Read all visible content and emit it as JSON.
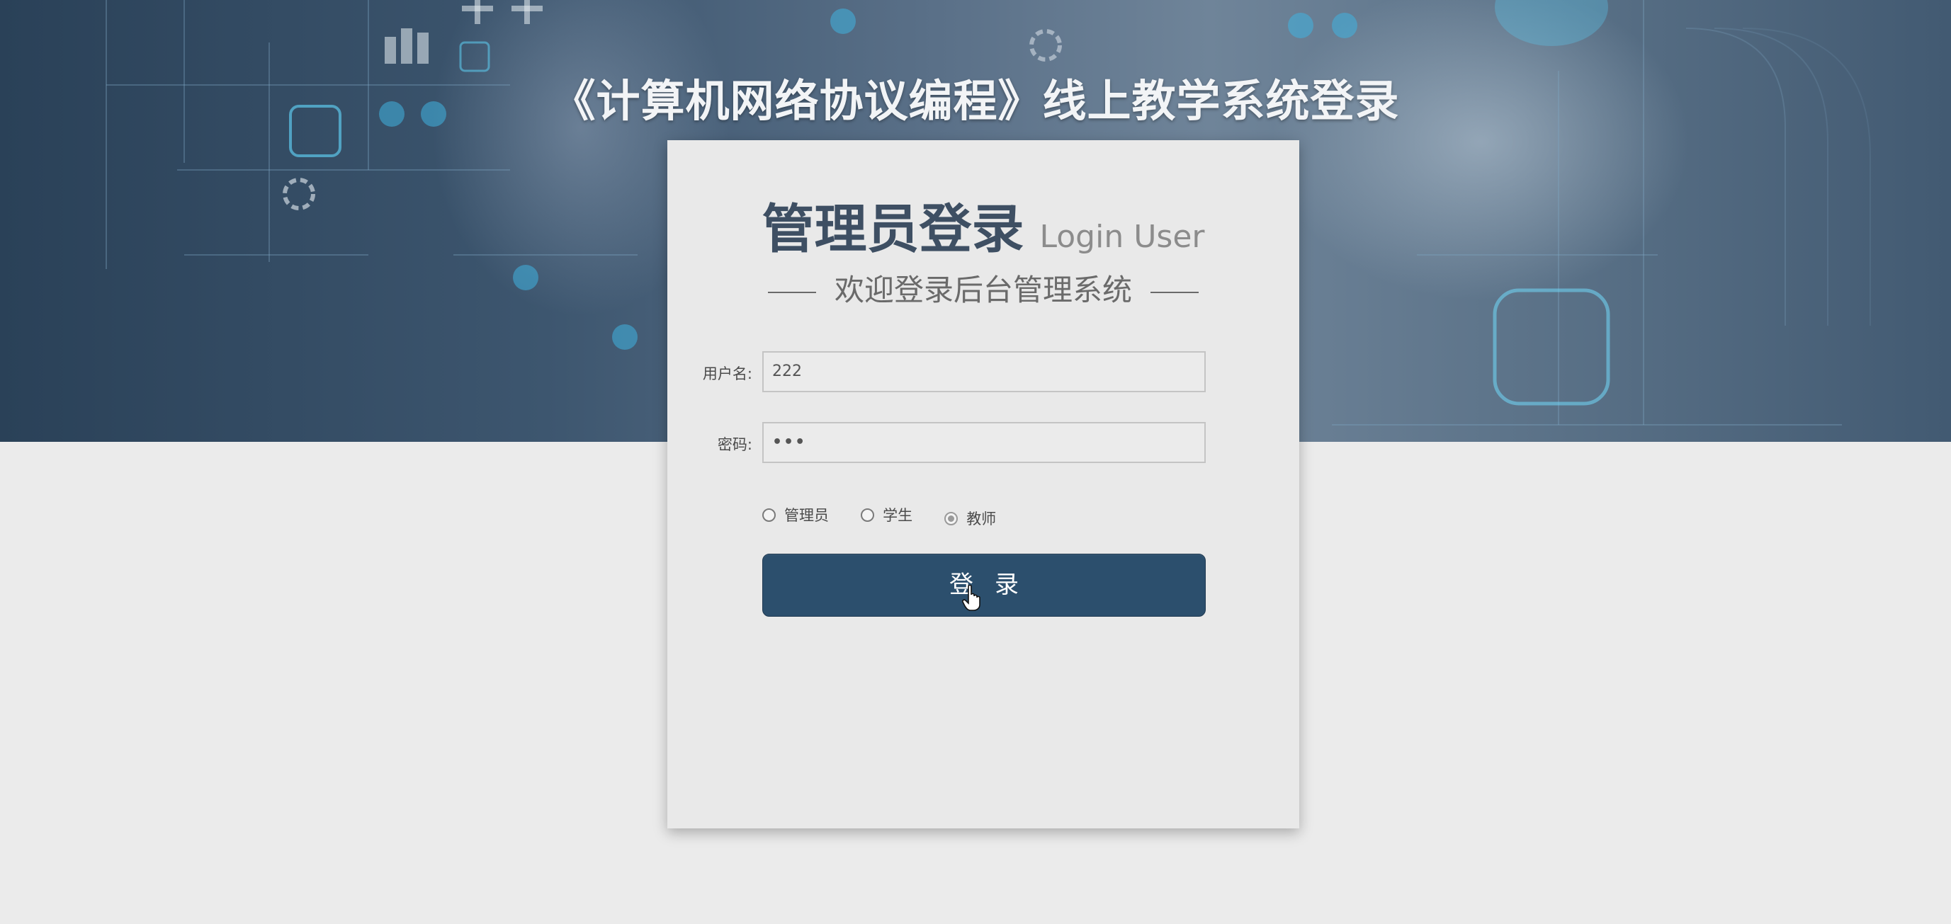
{
  "page": {
    "title": "《计算机网络协议编程》线上教学系统登录"
  },
  "login": {
    "heading": "管理员登录",
    "heading_sub": "Login User",
    "welcome": "欢迎登录后台管理系统",
    "username_label": "用户名:",
    "username_value": "222",
    "password_label": "密码:",
    "password_value": "•••",
    "roles": [
      {
        "label": "管理员",
        "checked": false
      },
      {
        "label": "学生",
        "checked": false
      },
      {
        "label": "教师",
        "checked": true
      }
    ],
    "submit_label": "登录"
  },
  "colors": {
    "button": "#2c4f6d",
    "heading": "#3e4f63",
    "background": "#ebebeb"
  }
}
